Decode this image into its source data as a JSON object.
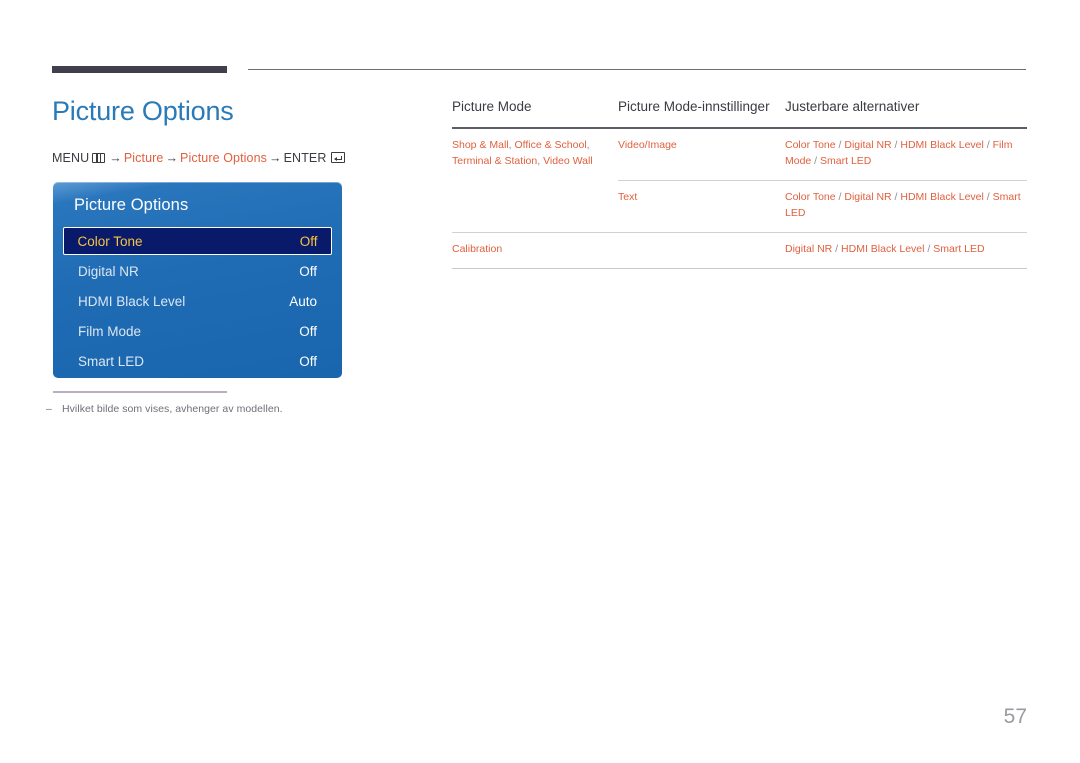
{
  "page": {
    "title": "Picture Options",
    "number": "57"
  },
  "menu_path": {
    "menu_label": "MENU",
    "menu_icon": "menu-keypad-icon",
    "arrow": "→",
    "step1": "Picture",
    "step2": "Picture Options",
    "enter_label": "ENTER",
    "enter_icon": "enter-key-icon"
  },
  "osd": {
    "title": "Picture Options",
    "items": [
      {
        "label": "Color Tone",
        "value": "Off",
        "selected": true
      },
      {
        "label": "Digital NR",
        "value": "Off",
        "selected": false
      },
      {
        "label": "HDMI Black Level",
        "value": "Auto",
        "selected": false
      },
      {
        "label": "Film Mode",
        "value": "Off",
        "selected": false
      },
      {
        "label": "Smart LED",
        "value": "Off",
        "selected": false
      }
    ]
  },
  "footnote": {
    "dash": "–",
    "text": "Hvilket bilde som vises, avhenger av modellen."
  },
  "table": {
    "headers": [
      "Picture Mode",
      "Picture Mode-innstillinger",
      "Justerbare alternativer"
    ],
    "rows": [
      {
        "picture_mode": "Shop & Mall, Office & School, Terminal & Station, Video Wall",
        "settings": "Video/Image",
        "options": "Color Tone / Digital NR / HDMI Black Level / Film Mode / Smart LED"
      },
      {
        "picture_mode": "",
        "settings": "Text",
        "options": "Color Tone / Digital NR / HDMI Black Level / Smart LED"
      },
      {
        "picture_mode": "Calibration",
        "settings": "",
        "options": "Digital NR / HDMI Black Level / Smart LED"
      }
    ]
  },
  "colors": {
    "heading_blue": "#2b7ab8",
    "accent_orange": "#e0603f",
    "osd_blue": "#1f6cb4",
    "osd_selected_bg": "#0a1a6b",
    "osd_selected_text": "#f5c542",
    "rule_dark": "#413f4c"
  }
}
